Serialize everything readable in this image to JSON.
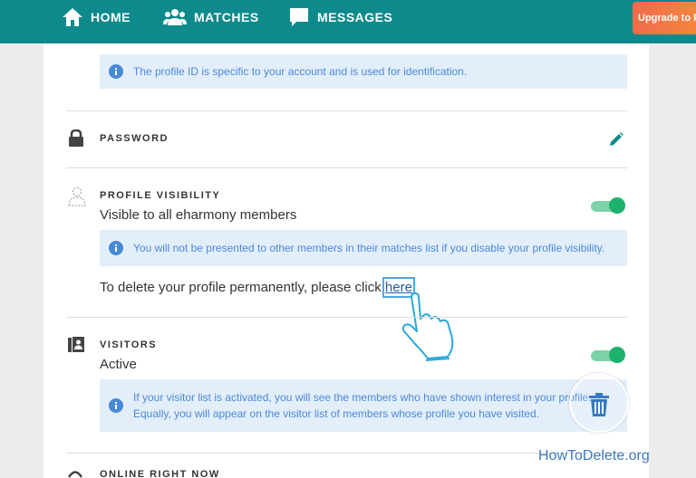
{
  "nav": {
    "home": "HOME",
    "matches": "MATCHES",
    "messages": "MESSAGES",
    "upgrade": "Upgrade to Pr"
  },
  "profile_id": {
    "info": "The profile ID is specific to your account and is used for identification."
  },
  "password": {
    "title": "PASSWORD",
    "icon": "lock-icon",
    "edit_icon": "pencil-icon"
  },
  "visibility": {
    "title": "PROFILE VISIBILITY",
    "status": "Visible to all eharmony members",
    "toggle_on": true,
    "info": "You will not be presented to other members in their matches list if you disable your profile visibility.",
    "delete_prefix": "To delete your profile permanently, please click ",
    "delete_link": "here",
    "delete_suffix": "."
  },
  "visitors": {
    "title": "VISITORS",
    "status": "Active",
    "toggle_on": true,
    "info_line1": "If your visitor list is activated, you will see the members who have shown interest in your profile.",
    "info_line2": "Equally, you will appear on the visitor list of members whose profile you have visited."
  },
  "online": {
    "title": "ONLINE RIGHT NOW"
  },
  "watermark": "HowToDelete.org",
  "colors": {
    "header": "#0e8a8c",
    "toggle": "#1db36e",
    "info_bg": "#e3eefb",
    "info_text": "#4a89d6",
    "upgrade": "#f26a4b"
  }
}
